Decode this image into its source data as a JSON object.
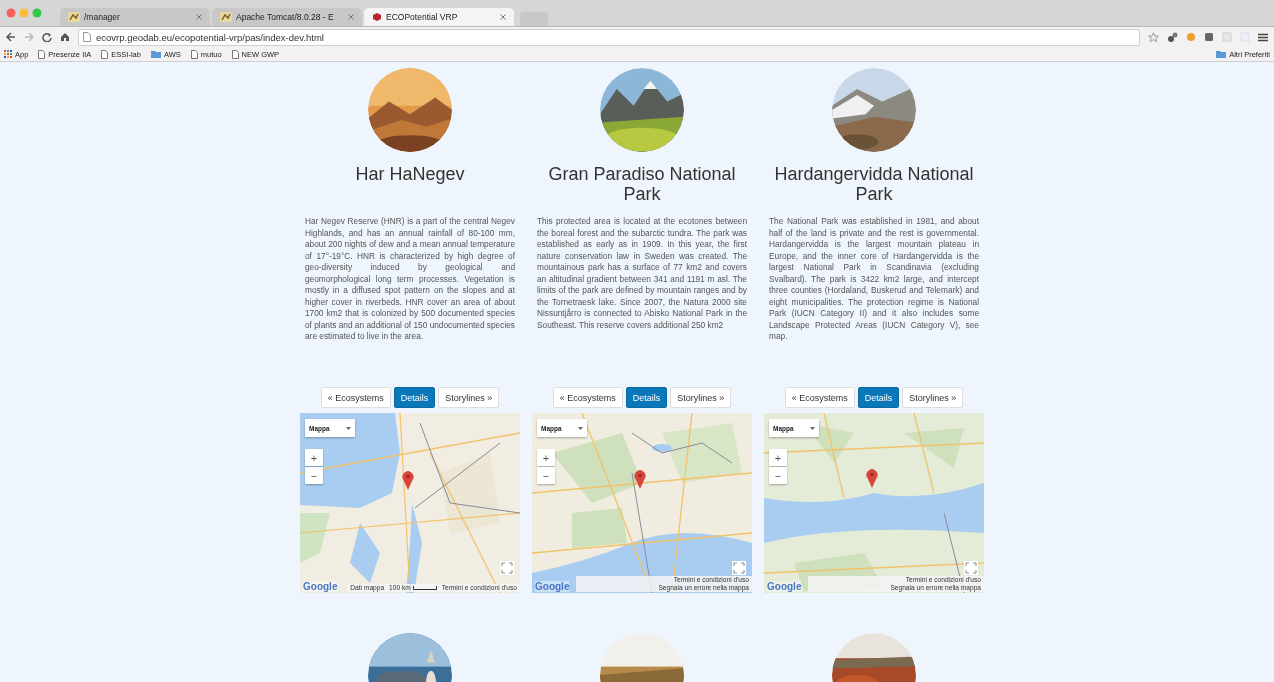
{
  "browser": {
    "tabs": [
      {
        "label": "/manager",
        "selected": false
      },
      {
        "label": "Apache Tomcat/8.0.28 - E",
        "selected": false
      },
      {
        "label": "ECOPotential VRP",
        "selected": true
      }
    ],
    "address": "ecovrp.geodab.eu/ecopotential-vrp/pas/index-dev.html",
    "bookmarks": [
      {
        "label": "App",
        "kind": "apps"
      },
      {
        "label": "Presenze IIA",
        "kind": "page"
      },
      {
        "label": "ESSI-lab",
        "kind": "page"
      },
      {
        "label": "AWS",
        "kind": "folder"
      },
      {
        "label": "mutuo",
        "kind": "page"
      },
      {
        "label": "NEW GWP",
        "kind": "page"
      }
    ],
    "other_bookmarks": "Altri Preferiti"
  },
  "parks": [
    {
      "title": "Har HaNegev",
      "description": "Har Negev Reserve (HNR) is a part of the central Negev Highlands, and has an annual rainfall of 80-100 mm, about 200 nights of dew and a mean annual temperature of 17°-19°C. HNR is characterized by high degree of geo-diversity induced by geological and geomorphological long term processes. Vegetation is mostly in a diffused spot pattern on the slopes and at higher cover in riverbeds. HNR cover an area of about 1700 km2 that is colonized by 500 documented species of plants and an additional of 150 undocumented species are estimated to live in the area.",
      "buttons": [
        {
          "label": "« Ecosystems",
          "selected": false
        },
        {
          "label": "Details",
          "selected": true
        },
        {
          "label": "Storylines »",
          "selected": false
        }
      ],
      "map": {
        "map_type": "Mappa",
        "zoom_in": "+",
        "zoom_out": "−",
        "logo": "Google",
        "scale": "100 km",
        "footer": [
          "Dati mappa",
          "Termini e condizioni d'uso"
        ]
      }
    },
    {
      "title": "Gran Paradiso National Park",
      "description": "This protected area is located at the ecotones between the boreal forest and the subarctic tundra. The park was established as early as in 1909. In this year, the first nature conservation law in Sweden was created. The mountainous park has a surface of 77 km2 and covers an altitudinal gradient between 341 and 1191 m asl. The limits of the park are defined by mountain ranges and by the Tornetraesk lake. Since 2007, the Natura 2000 site Nissuntjårro is connected to Abisko National Park in the Southeast. This reserve covers additional 250 km2",
      "buttons": [
        {
          "label": "« Ecosystems",
          "selected": false
        },
        {
          "label": "Details",
          "selected": true
        },
        {
          "label": "Storylines »",
          "selected": false
        }
      ],
      "map": {
        "map_type": "Mappa",
        "zoom_in": "+",
        "zoom_out": "−",
        "logo": "Google",
        "footer": [
          "Termini e condizioni d'uso",
          "Segnala un errore nella mappa"
        ]
      }
    },
    {
      "title": "Hardangervidda National Park",
      "description": "The National Park was established in 1981, and about half of the land is private and the rest is governmental. Hardangervidda is the largest mountain plateau in Europe, and the inner core of Hardangervidda is the largest National Park in Scandinavia (excluding Svalbard). The park is 3422 km2 large, and intercept three counties (Hordaland, Buskerud and Telemark) and eight municipalities. The protection regime is National Park (IUCN Category II) and it also includes some Landscape Protected Areas (IUCN Category V), see map.",
      "buttons": [
        {
          "label": "« Ecosystems",
          "selected": false
        },
        {
          "label": "Details",
          "selected": true
        },
        {
          "label": "Storylines »",
          "selected": false
        }
      ],
      "map": {
        "map_type": "Mappa",
        "zoom_in": "+",
        "zoom_out": "−",
        "logo": "Google",
        "footer": [
          "Termini e condizioni d'uso",
          "Segnala un errore nella mappa"
        ]
      }
    }
  ]
}
